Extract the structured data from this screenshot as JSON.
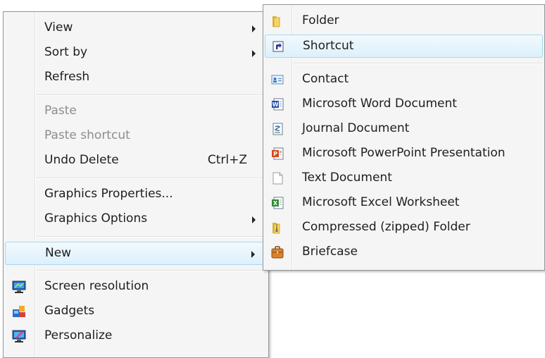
{
  "context_menu": {
    "items": [
      {
        "label": "View",
        "submenu": true
      },
      {
        "label": "Sort by",
        "submenu": true
      },
      {
        "label": "Refresh"
      },
      {
        "label": "Paste",
        "disabled": true
      },
      {
        "label": "Paste shortcut",
        "disabled": true
      },
      {
        "label": "Undo Delete",
        "shortcut": "Ctrl+Z"
      },
      {
        "label": "Graphics Properties..."
      },
      {
        "label": "Graphics Options",
        "submenu": true
      },
      {
        "label": "New",
        "submenu": true,
        "highlighted": true
      },
      {
        "label": "Screen resolution",
        "icon": "screen-resolution-icon"
      },
      {
        "label": "Gadgets",
        "icon": "gadgets-icon"
      },
      {
        "label": "Personalize",
        "icon": "personalize-icon"
      }
    ]
  },
  "new_submenu": {
    "items": [
      {
        "label": "Folder",
        "icon": "folder-icon"
      },
      {
        "label": "Shortcut",
        "icon": "shortcut-icon",
        "highlighted": true
      },
      {
        "label": "Contact",
        "icon": "contact-icon"
      },
      {
        "label": "Microsoft Word Document",
        "icon": "word-document-icon"
      },
      {
        "label": "Journal Document",
        "icon": "journal-document-icon"
      },
      {
        "label": "Microsoft PowerPoint Presentation",
        "icon": "powerpoint-icon"
      },
      {
        "label": "Text Document",
        "icon": "text-document-icon"
      },
      {
        "label": "Microsoft Excel Worksheet",
        "icon": "excel-icon"
      },
      {
        "label": "Compressed (zipped) Folder",
        "icon": "zip-folder-icon"
      },
      {
        "label": "Briefcase",
        "icon": "briefcase-icon"
      }
    ]
  },
  "colors": {
    "menu_background": "#f5f5f5",
    "menu_border": "#979797",
    "highlight_border": "#a8d8eb",
    "disabled_text": "#8d8d8d"
  }
}
